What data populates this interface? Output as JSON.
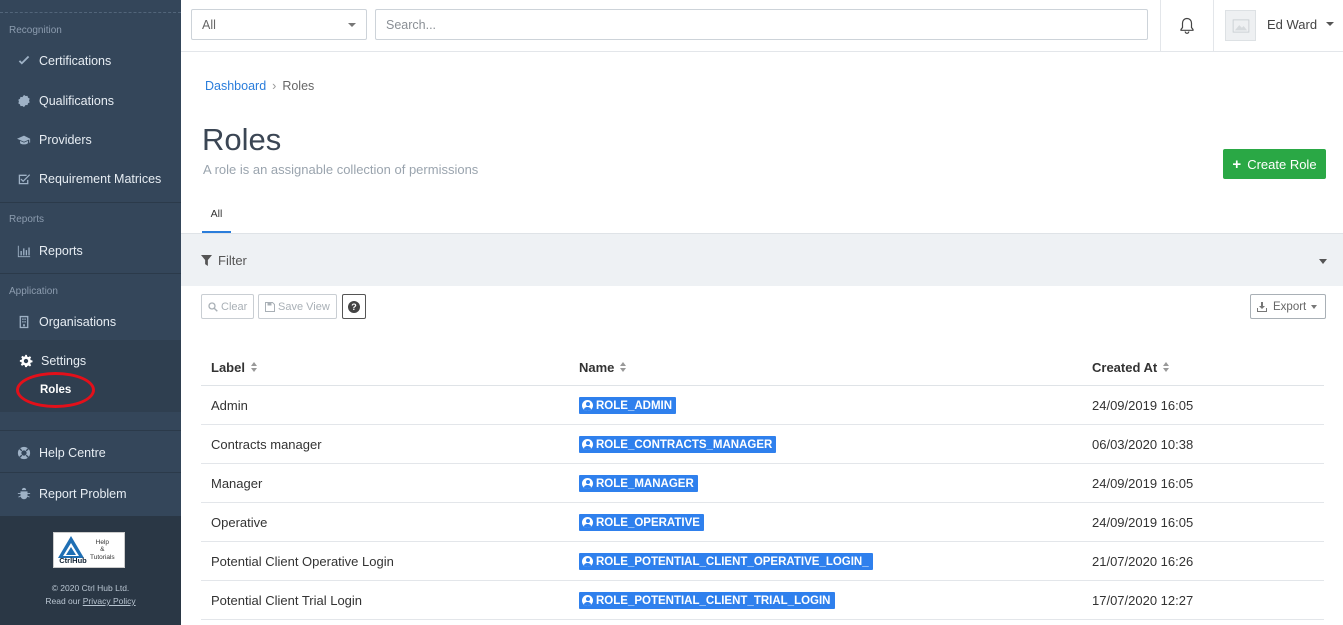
{
  "sidebar": {
    "sections": {
      "recognition": "Recognition",
      "reports": "Reports",
      "application": "Application"
    },
    "items": {
      "certifications": "Certifications",
      "qualifications": "Qualifications",
      "providers": "Providers",
      "requirement_matrices": "Requirement Matrices",
      "reports": "Reports",
      "organisations": "Organisations",
      "settings": "Settings",
      "roles": "Roles",
      "help_centre": "Help Centre",
      "report_problem": "Report Problem"
    },
    "footer": {
      "logo_text": "CtrlHub",
      "logo_help_1": "Help",
      "logo_help_2": "&",
      "logo_help_3": "Tutorials",
      "copyright": "© 2020 Ctrl Hub Ltd.",
      "read_our": "Read our",
      "privacy_policy": "Privacy Policy"
    }
  },
  "topbar": {
    "scope_select": "All",
    "search_placeholder": "Search...",
    "user_name": "Ed Ward"
  },
  "breadcrumb": {
    "home": "Dashboard",
    "current": "Roles"
  },
  "page": {
    "title": "Roles",
    "subtitle": "A role is an assignable collection of permissions",
    "create_button": "Create Role",
    "tab_all": "All",
    "filter": "Filter"
  },
  "toolbar": {
    "clear": "Clear",
    "save_view": "Save View",
    "help": "?",
    "export": "Export"
  },
  "table": {
    "columns": {
      "label": "Label",
      "name": "Name",
      "created_at": "Created At"
    },
    "rows": [
      {
        "label": "Admin",
        "name": "ROLE_ADMIN",
        "created_at": "24/09/2019 16:05"
      },
      {
        "label": "Contracts manager",
        "name": "ROLE_CONTRACTS_MANAGER",
        "created_at": "06/03/2020 10:38"
      },
      {
        "label": "Manager",
        "name": "ROLE_MANAGER",
        "created_at": "24/09/2019 16:05"
      },
      {
        "label": "Operative",
        "name": "ROLE_OPERATIVE",
        "created_at": "24/09/2019 16:05"
      },
      {
        "label": "Potential Client Operative Login",
        "name": "ROLE_POTENTIAL_CLIENT_OPERATIVE_LOGIN_",
        "created_at": "21/07/2020 16:26"
      },
      {
        "label": "Potential Client Trial Login",
        "name": "ROLE_POTENTIAL_CLIENT_TRIAL_LOGIN",
        "created_at": "17/07/2020 12:27"
      }
    ]
  },
  "colors": {
    "sidebar_bg": "#34465a",
    "accent_blue": "#2a7ddb",
    "create_green": "#2aa845",
    "badge_blue": "#2f80ed",
    "annotation_red": "#e3101a"
  }
}
